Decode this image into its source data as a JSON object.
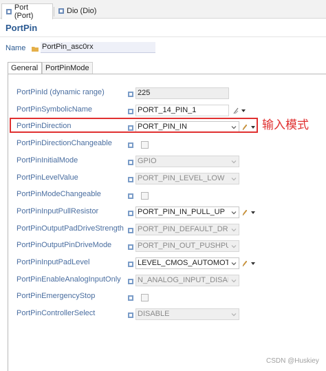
{
  "editor_tabs": [
    {
      "label": "Port (Port)",
      "active": true
    },
    {
      "label": "Dio (Dio)",
      "active": false
    }
  ],
  "title": "PortPin",
  "name": {
    "label": "Name",
    "value": "PortPin_asc0rx"
  },
  "inner_tabs": [
    "General",
    "PortPinMode"
  ],
  "fields": [
    {
      "label": "PortPinId (dynamic range)",
      "kind": "text",
      "value": "225"
    },
    {
      "label": "PortPinSymbolicName",
      "kind": "text-white",
      "value": "PORT_14_PIN_1"
    },
    {
      "label": "PortPinDirection",
      "kind": "combo",
      "value": "PORT_PIN_IN"
    },
    {
      "label": "PortPinDirectionChangeable",
      "kind": "checkbox",
      "value": ""
    },
    {
      "label": "PortPinInitialMode",
      "kind": "combo-disabled",
      "value": "GPIO"
    },
    {
      "label": "PortPinLevelValue",
      "kind": "combo-disabled",
      "value": "PORT_PIN_LEVEL_LOW"
    },
    {
      "label": "PortPinModeChangeable",
      "kind": "checkbox",
      "value": ""
    },
    {
      "label": "PortPinInputPullResistor",
      "kind": "combo",
      "value": "PORT_PIN_IN_PULL_UP"
    },
    {
      "label": "PortPinOutputPadDriveStrength",
      "kind": "combo-disabled",
      "value": "PORT_PIN_DEFAULT_DRIVER"
    },
    {
      "label": "PortPinOutputPinDriveMode",
      "kind": "combo-disabled",
      "value": "PORT_PIN_OUT_PUSHPULL"
    },
    {
      "label": "PortPinInputPadLevel",
      "kind": "combo",
      "value": "LEVEL_CMOS_AUTOMOTIVE"
    },
    {
      "label": "PortPinEnableAnalogInputOnly",
      "kind": "combo-disabled",
      "value": "N_ANALOG_INPUT_DISABLE"
    },
    {
      "label": "PortPinEmergencyStop",
      "kind": "checkbox",
      "value": ""
    },
    {
      "label": "PortPinControllerSelect",
      "kind": "combo-disabled",
      "value": "DISABLE"
    }
  ],
  "annotation": "输入模式",
  "watermark": "CSDN @Huskiey",
  "colors": {
    "accent": "#2b5a92",
    "label": "#4a6ea0",
    "highlight": "#e03030"
  }
}
